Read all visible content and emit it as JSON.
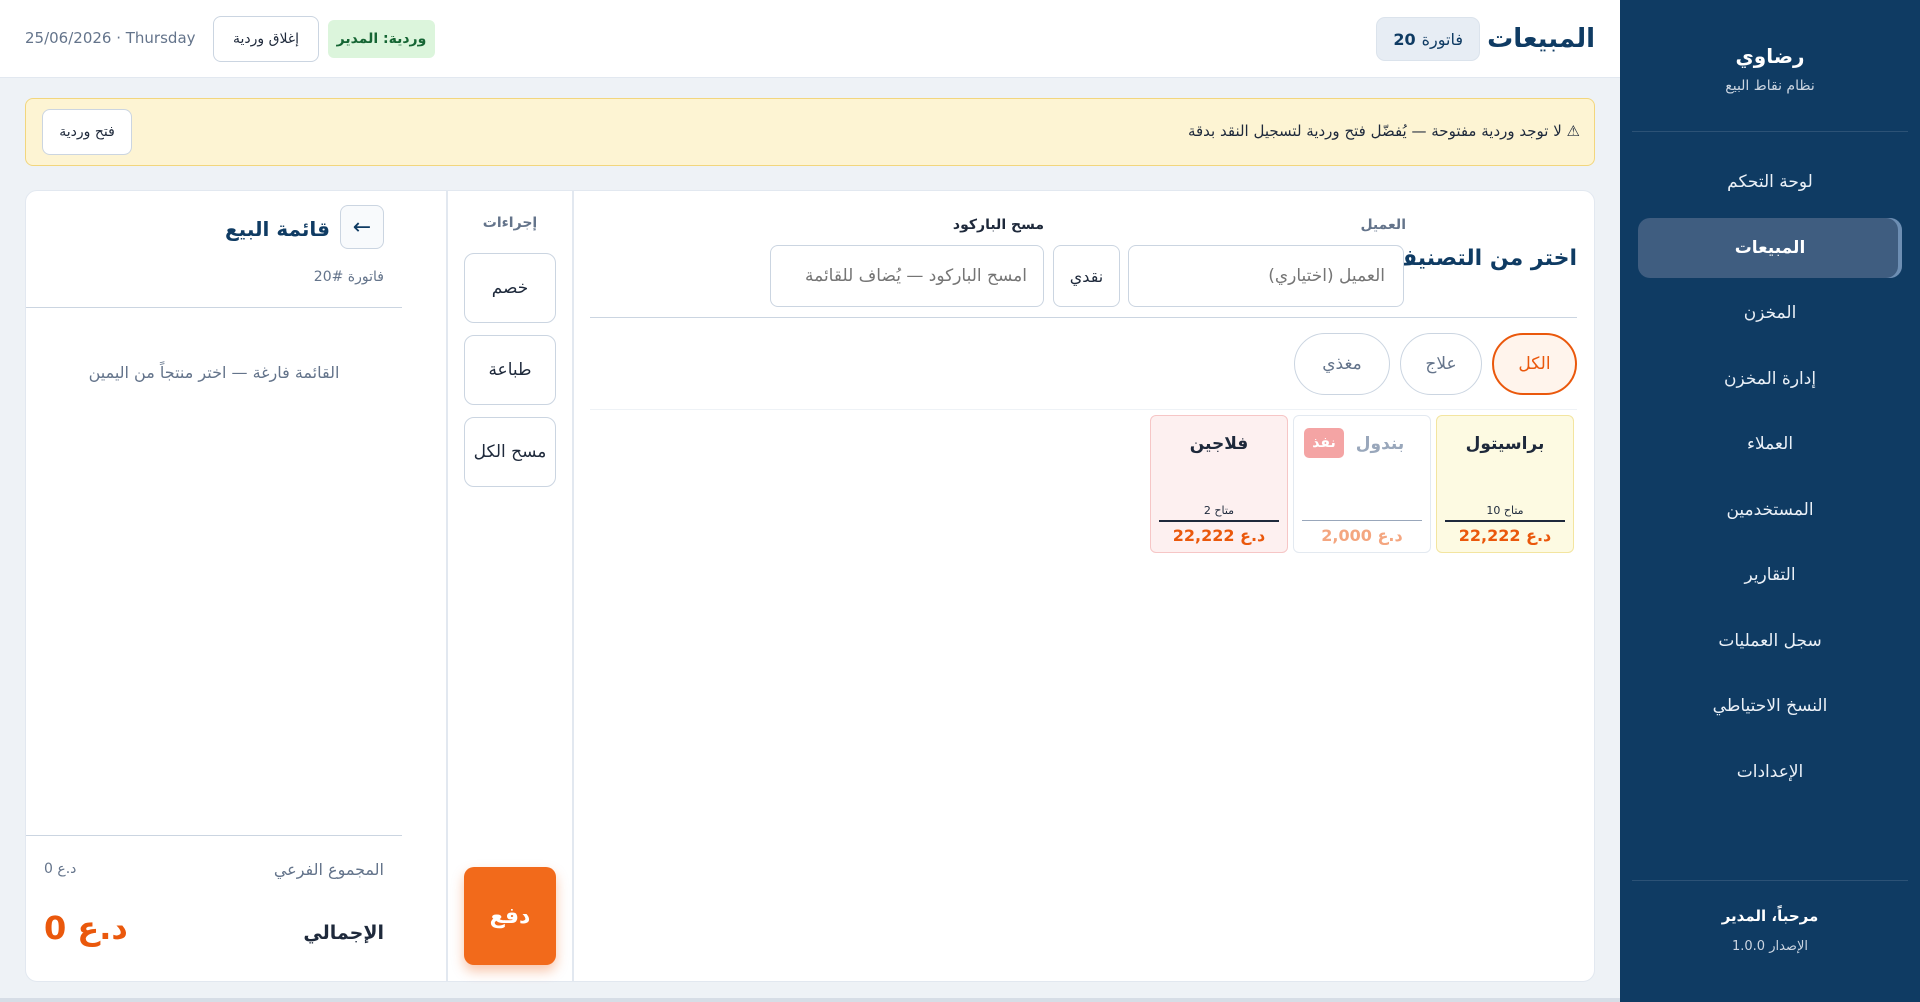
{
  "sidebar": {
    "brand_name": "رضاوي",
    "brand_sub": "نظام نقاط البيع",
    "items": [
      {
        "label": "لوحة التحكم"
      },
      {
        "label": "المبيعات"
      },
      {
        "label": "المخزن"
      },
      {
        "label": "إدارة المخزن"
      },
      {
        "label": "العملاء"
      },
      {
        "label": "المستخدمين"
      },
      {
        "label": "التقارير"
      },
      {
        "label": "سجل العمليات"
      },
      {
        "label": "النسخ الاحتياطي"
      },
      {
        "label": "الإعدادات"
      }
    ],
    "active_index": 1,
    "welcome": "مرحباً، المدير",
    "version": "الإصدار 1.0.0"
  },
  "header": {
    "title": "المبيعات",
    "invoice_label": "فاتورة",
    "invoice_number": "20",
    "shift_badge": "وردية: المدير",
    "close_shift": "إغلاق وردية",
    "date": "25/06/2026 · Thursday"
  },
  "alert": {
    "text": "⚠ لا توجد وردية مفتوحة — يُفضّل فتح وردية لتسجيل النقد بدقة",
    "button": "فتح وردية"
  },
  "products": {
    "title": "اختر من التصنيف",
    "customer_label": "العميل",
    "customer_placeholder": "العميل (اختياري)",
    "cash_button": "نقدي",
    "barcode_label": "مسح الباركود",
    "barcode_placeholder": "امسح الباركود — يُضاف للقائمة",
    "categories": [
      "الكل",
      "علاج",
      "مغذي"
    ],
    "active_category": "الكل",
    "items": [
      {
        "name": "براسيتول",
        "stock": "متاح 10",
        "price": "22,222 د.ع"
      },
      {
        "name": "بندول",
        "badge": "نفذ",
        "stock": "",
        "price": "2,000 د.ع"
      },
      {
        "name": "فلاجين",
        "stock": "متاح 2",
        "price": "22,222 د.ع"
      }
    ]
  },
  "actions": {
    "label": "إجراءات",
    "discount": "خصم",
    "print": "طباعة",
    "clear_all": "مسح الكل",
    "pay": "دفع"
  },
  "cart": {
    "title": "قائمة البيع",
    "back_icon": "arrow-left-icon",
    "invoice_label": "فاتورة #20",
    "empty_message": "القائمة فارغة — اختر منتجاً من اليمين",
    "subtotal_label": "المجموع الفرعي",
    "subtotal_value": "0 د.ع",
    "total_label": "الإجمالي",
    "total_value": "0 د.ع"
  }
}
